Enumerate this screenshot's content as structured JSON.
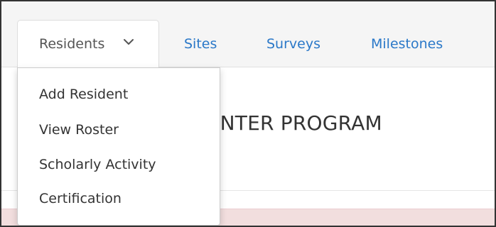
{
  "nav": {
    "tabs": [
      {
        "label": "Residents",
        "active": true
      },
      {
        "label": "Sites"
      },
      {
        "label": "Surveys"
      },
      {
        "label": "Milestones"
      }
    ],
    "link_color": "#2a78c8"
  },
  "dropdown": {
    "items": [
      {
        "label": "Add Resident"
      },
      {
        "label": "View Roster"
      },
      {
        "label": "Scholarly Activity"
      },
      {
        "label": "Certification"
      }
    ]
  },
  "page": {
    "heading_visible": "CENTER PROGRAM"
  },
  "alert": {
    "color": "#f2dede"
  }
}
